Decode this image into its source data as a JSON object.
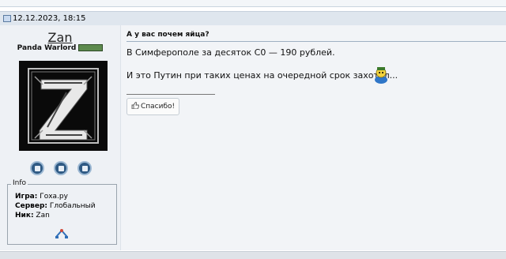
{
  "post": {
    "datetime": "12.12.2023, 18:15",
    "subject": "А у вас почем яйца?",
    "body": {
      "line1": "В Симферополе за десяток С0 — 190 рублей.",
      "line2": "И это Путин при таких ценах на очередной срок захотел..."
    },
    "thanks_label": "Спасибо!"
  },
  "author": {
    "username": "Zan",
    "title": "Panda Warlord",
    "info": {
      "legend": "Info",
      "game_label": "Игра:",
      "game_value": "Гоха.ру",
      "server_label": "Сервер:",
      "server_value": "Глобальный",
      "nick_label": "Ник:",
      "nick_value": "Zan"
    }
  },
  "icons": {
    "post": "post-icon",
    "actions": [
      "message-icon",
      "profile-icon",
      "posts-icon"
    ],
    "smiley": "smiley-icon",
    "thanks": "thumbs-up-icon",
    "badge": "game-badge-icon"
  },
  "colors": {
    "header_bg": "#dfe6ee",
    "sidebar_bg": "#eef1f5",
    "content_bg": "#f2f4f7",
    "action_blue": "#2f5a84"
  }
}
